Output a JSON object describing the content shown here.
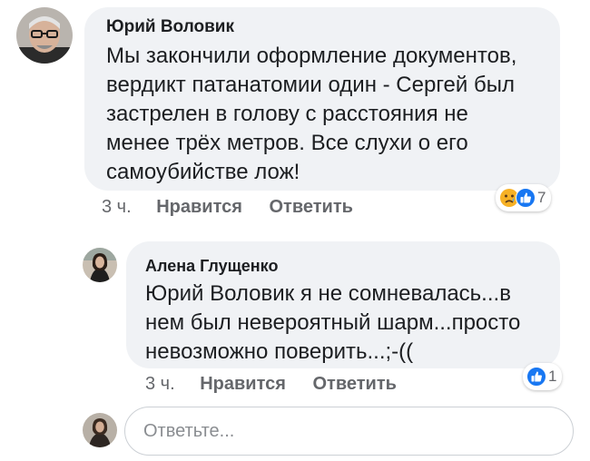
{
  "comments": [
    {
      "author": "Юрий Воловик",
      "lines": [
        "Мы закончили оформление документов,",
        "вердикт патанатомии один - Сергей был",
        "застрелен в голову с расстояния не",
        "менее трёх метров. Все слухи о его",
        "самоубийстве лож!"
      ],
      "time": "3 ч.",
      "like_label": "Нравится",
      "reply_label": "Ответить",
      "reactions": [
        "sad-icon",
        "like-icon"
      ],
      "reaction_count": "7"
    },
    {
      "author": "Алена Глущенко",
      "lines": [
        "Юрий Воловик я не сомневалась...в",
        "нем был невероятный шарм...просто",
        "невозможно поверить...;-(("
      ],
      "time": "3 ч.",
      "like_label": "Нравится",
      "reply_label": "Ответить",
      "reactions": [
        "like-icon"
      ],
      "reaction_count": "1"
    }
  ],
  "reply_input": {
    "placeholder": "Ответьте..."
  },
  "colors": {
    "bubble": "#f0f2f5",
    "like_blue": "#1877f2",
    "sad_yellow": "#f7b125",
    "meta_grey": "#65676b"
  }
}
